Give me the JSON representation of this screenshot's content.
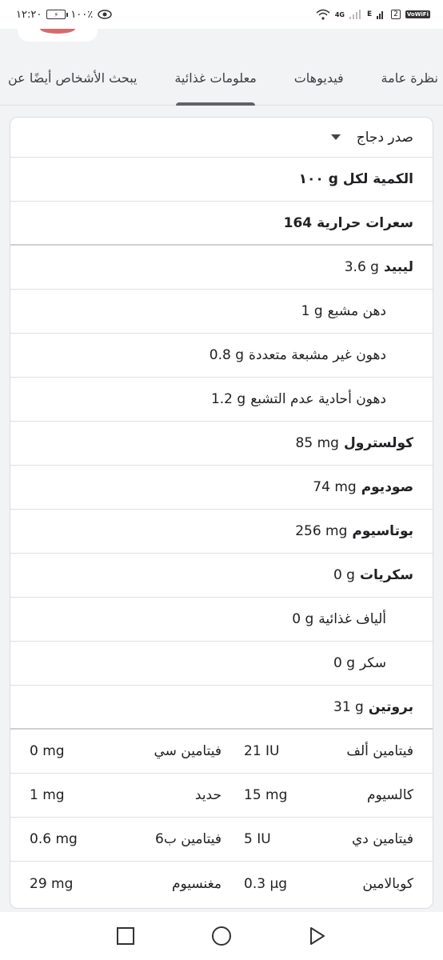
{
  "status_bar": {
    "time": "١٢:٢٠",
    "battery": "١٠٠٪",
    "net_4g": "4G",
    "net_e": "E",
    "sim": "2",
    "volte": "VoWiFi"
  },
  "tabs": [
    {
      "label": "نظرة عامة"
    },
    {
      "label": "فيديوهات"
    },
    {
      "label": "معلومات غذائية"
    },
    {
      "label": "يبحث الأشخاص أيضًا عن"
    }
  ],
  "nutrition": {
    "food_selected": "صدر دجاج",
    "serving_label": "الكمية لكل",
    "serving_value": "١٠٠ g",
    "calories_label": "سعرات حرارية",
    "calories_value": "164",
    "rows": [
      {
        "label": "ليبيد",
        "value": "3.6 g",
        "bold": true
      },
      {
        "label": "دهن مشبع",
        "value": "1 g",
        "bold": false
      },
      {
        "label": "دهون غير مشبعة متعددة",
        "value": "0.8 g",
        "bold": false
      },
      {
        "label": "دهون أحادية عدم التشبع",
        "value": "1.2 g",
        "bold": false
      },
      {
        "label": "كولسترول",
        "value": "85 mg",
        "bold": true
      },
      {
        "label": "صوديوم",
        "value": "74 mg",
        "bold": true
      },
      {
        "label": "بوتاسيوم",
        "value": "256 mg",
        "bold": true
      },
      {
        "label": "سكريات",
        "value": "0 g",
        "bold": true
      },
      {
        "label": "ألياف غذائية",
        "value": "0 g",
        "bold": false
      },
      {
        "label": "سكر",
        "value": "0 g",
        "bold": false
      },
      {
        "label": "بروتين",
        "value": "31 g",
        "bold": true
      }
    ],
    "vitamins": [
      {
        "a_label": "فيتامين ألف",
        "a_value": "21 IU",
        "b_label": "فيتامين سي",
        "b_value": "0 mg"
      },
      {
        "a_label": "كالسيوم",
        "a_value": "15 mg",
        "b_label": "حديد",
        "b_value": "1 mg"
      },
      {
        "a_label": "فيتامين دي",
        "a_value": "5 IU",
        "b_label": "فيتامين ب6",
        "b_value": "0.6 mg"
      },
      {
        "a_label": "كوبالامين",
        "a_value": "0.3 µg",
        "b_label": "مغنسيوم",
        "b_value": "29 mg"
      }
    ]
  },
  "nav": {
    "back_icon": "back-triangle-icon",
    "home_icon": "home-circle-icon",
    "recents_icon": "recents-square-icon"
  }
}
